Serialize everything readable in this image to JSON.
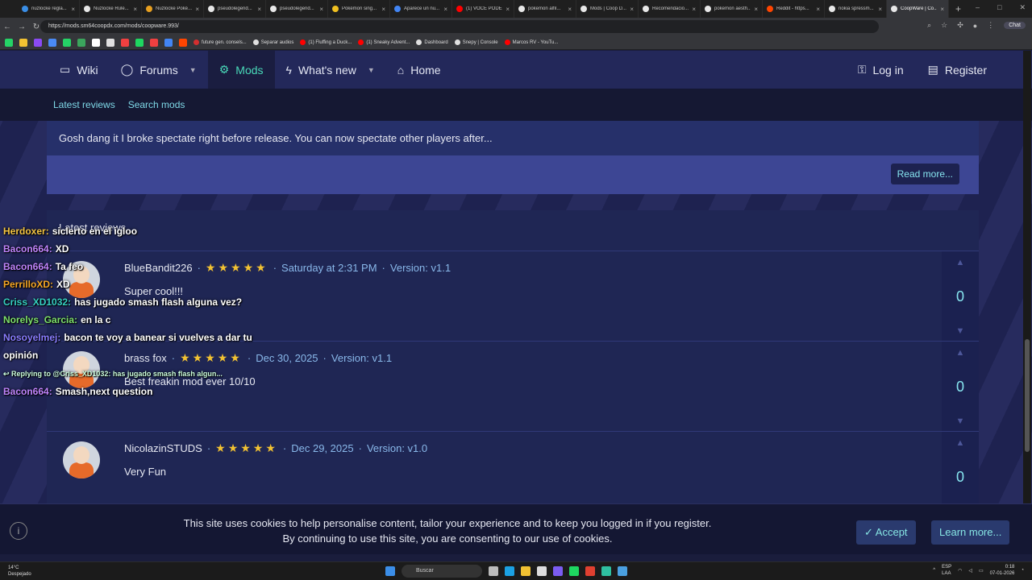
{
  "browser": {
    "tabs": [
      {
        "title": "nuzlocke regla...",
        "color": "#3a8ee6"
      },
      {
        "title": "Nuzlocke Rule...",
        "color": "#e8e8e8"
      },
      {
        "title": "Nuzlocke Poké...",
        "color": "#e8a020"
      },
      {
        "title": "pseudolegend...",
        "color": "#e8e8e8"
      },
      {
        "title": "pseudolegend...",
        "color": "#e8e8e8"
      },
      {
        "title": "Pokémon sing...",
        "color": "#f0c020"
      },
      {
        "title": "Aparece un nu...",
        "color": "#4285f4"
      },
      {
        "title": "(1) VOCÊ PODE...",
        "color": "#ff0000"
      },
      {
        "title": "pokemon alfil...",
        "color": "#e8e8e8"
      },
      {
        "title": "Mods | Coop D...",
        "color": "#e8e8e8"
      },
      {
        "title": "Recomendacio...",
        "color": "#e8e8e8"
      },
      {
        "title": "pokemon aesth...",
        "color": "#e8e8e8"
      },
      {
        "title": "Reddit - https...",
        "color": "#ff4500"
      },
      {
        "title": "nokia spressm...",
        "color": "#e8e8e8"
      },
      {
        "title": "CoopWare | Co...",
        "color": "#e8e8e8"
      }
    ],
    "active_tab": 14,
    "url": "https://mods.sm64coopdx.com/mods/coopware.993/",
    "chat_label": "Chat",
    "bookmarks": [
      {
        "label": "future gen. consels...",
        "color": "#d32f2f"
      },
      {
        "label": "Separar audios",
        "color": "#e0e0e0"
      },
      {
        "label": "(1) Fluffing a Duck...",
        "color": "#ff0000"
      },
      {
        "label": "(1) Sneaky Advent...",
        "color": "#ff0000"
      },
      {
        "label": "Dashboard",
        "color": "#e0e0e0"
      },
      {
        "label": "Snepy | Console",
        "color": "#e0e0e0"
      },
      {
        "label": "Marcos RV - YouTu...",
        "color": "#ff0000"
      }
    ]
  },
  "nav": {
    "items": [
      {
        "label": "Wiki",
        "icon": "book-icon"
      },
      {
        "label": "Forums",
        "icon": "chat-icon"
      },
      {
        "label": "Mods",
        "icon": "gears-icon"
      },
      {
        "label": "What's new",
        "icon": "bolt-icon"
      },
      {
        "label": "Home",
        "icon": "home-icon"
      }
    ],
    "login": "Log in",
    "register": "Register",
    "sub": [
      "Latest reviews",
      "Search mods"
    ]
  },
  "description": {
    "text": "Gosh dang it I broke spectate right before release. You can now spectate other players after...",
    "read_more": "Read more..."
  },
  "reviews": {
    "heading": "Latest reviews",
    "items": [
      {
        "user": "BlueBandit226",
        "stars": 5,
        "date": "Saturday at 2:31 PM",
        "version": "Version: v1.1",
        "body": "Super cool!!!",
        "votes": "0"
      },
      {
        "user": "brass fox",
        "stars": 5,
        "date": "Dec 30, 2025",
        "version": "Version: v1.1",
        "body": "Best freakin mod ever 10/10",
        "votes": "0"
      },
      {
        "user": "NicolazinSTUDS",
        "stars": 5,
        "date": "Dec 29, 2025",
        "version": "Version: v1.0",
        "body": "Very Fun",
        "votes": "0"
      }
    ]
  },
  "chat_overlay": [
    {
      "name": "Herdoxer:",
      "color": "#f5c542",
      "msg": "siclerto en el igloo"
    },
    {
      "name": "Bacon664:",
      "color": "#c084fc",
      "msg": "XD"
    },
    {
      "name": "Bacon664:",
      "color": "#c084fc",
      "msg": "Ta feo"
    },
    {
      "name": "PerrilloXD:",
      "color": "#f5a623",
      "msg": "XD"
    },
    {
      "name": "Criss_XD1032:",
      "color": "#35d0c0",
      "msg": "has jugado smash flash alguna vez?"
    },
    {
      "name": "Norelys_Garcia:",
      "color": "#7ee06b",
      "msg": "en la c"
    },
    {
      "name": "Nosoyelmej:",
      "color": "#8a7dff",
      "msg": "bacon te voy a banear si vuelves a dar tu opinión"
    },
    {
      "name": "Replying to @Criss_XD1032: has jugado smash flash algun...",
      "color": "#cfd",
      "msg": ""
    },
    {
      "name": "Bacon664:",
      "color": "#c084fc",
      "msg": "Smash,next question"
    }
  ],
  "cookie": {
    "line1": "This site uses cookies to help personalise content, tailor your experience and to keep you logged in if you register.",
    "line2": "By continuing to use this site, you are consenting to our use of cookies.",
    "accept": "Accept",
    "learn_more": "Learn more..."
  },
  "taskbar": {
    "temp": "14°C",
    "weather": "Despejado",
    "search": "Buscar",
    "lang1": "ESP",
    "lang2": "LAA",
    "time": "0:18",
    "date": "07-01-2026"
  }
}
